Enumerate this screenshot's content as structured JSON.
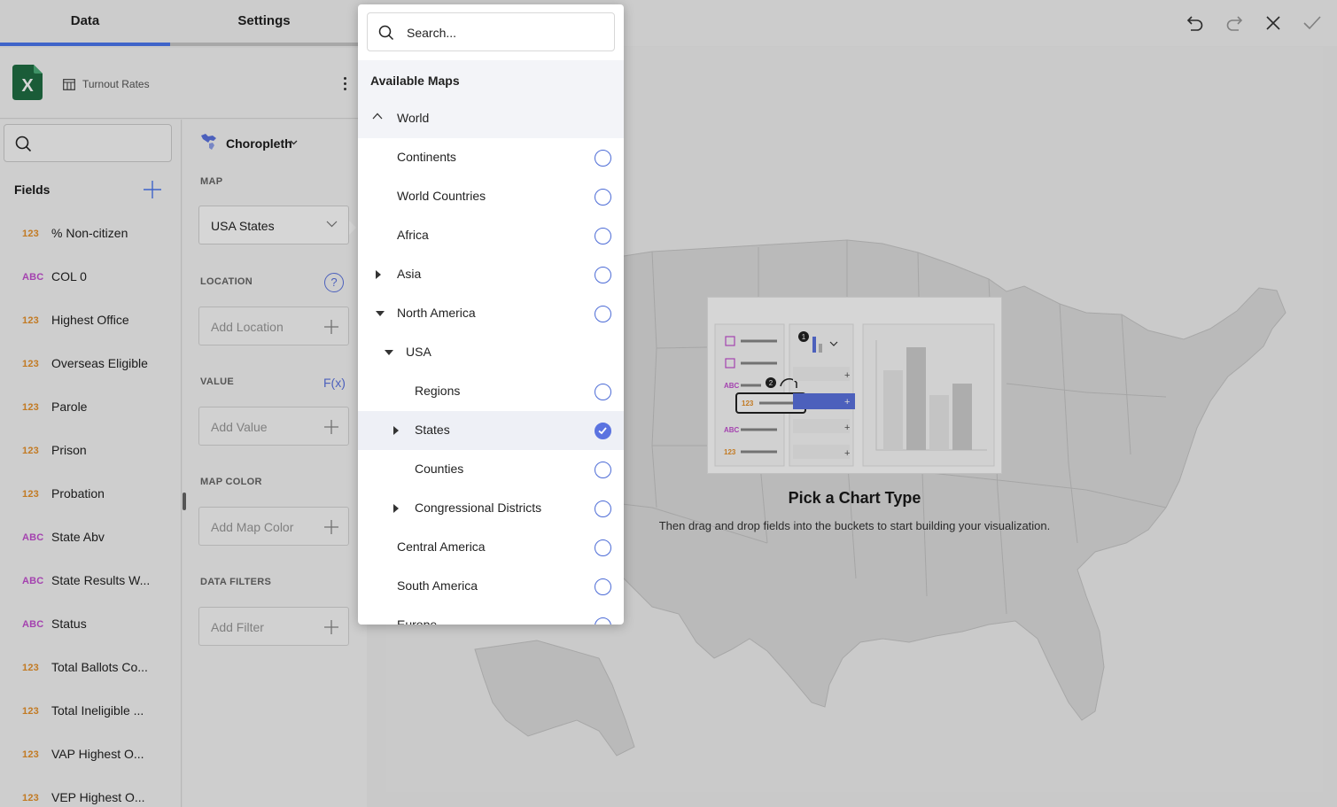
{
  "tabs": {
    "data": "Data",
    "settings": "Settings"
  },
  "source": {
    "name": "Turnout Rates",
    "icon": "excel-icon"
  },
  "fields": {
    "title": "Fields",
    "items": [
      {
        "type": "123",
        "label": "% Non-citizen"
      },
      {
        "type": "ABC",
        "label": "COL 0"
      },
      {
        "type": "123",
        "label": "Highest Office"
      },
      {
        "type": "123",
        "label": "Overseas Eligible"
      },
      {
        "type": "123",
        "label": "Parole"
      },
      {
        "type": "123",
        "label": "Prison"
      },
      {
        "type": "123",
        "label": "Probation"
      },
      {
        "type": "ABC",
        "label": "State Abv"
      },
      {
        "type": "ABC",
        "label": "State Results W..."
      },
      {
        "type": "ABC",
        "label": "Status"
      },
      {
        "type": "123",
        "label": "Total Ballots Co..."
      },
      {
        "type": "123",
        "label": "Total Ineligible ..."
      },
      {
        "type": "123",
        "label": "VAP Highest O..."
      },
      {
        "type": "123",
        "label": "VEP Highest O..."
      }
    ]
  },
  "config": {
    "chart_type": "Choropleth",
    "map_label": "MAP",
    "map_value": "USA States",
    "location_label": "LOCATION",
    "location_placeholder": "Add Location",
    "help": "?",
    "value_label": "VALUE",
    "fx": "F(x)",
    "value_placeholder": "Add Value",
    "map_color_label": "MAP COLOR",
    "map_color_placeholder": "Add Map Color",
    "filters_label": "DATA FILTERS",
    "filters_placeholder": "Add Filter"
  },
  "canvas": {
    "title": "Pick a Chart Type",
    "subtitle": "Then drag and drop fields into the buckets to start building your visualization.",
    "illus_types": [
      "ABC",
      "123",
      "ABC",
      "123"
    ],
    "illus_steps": [
      "1",
      "2"
    ],
    "illus_plus": "+"
  },
  "dropdown": {
    "search_placeholder": "Search...",
    "title": "Available Maps",
    "group": "World",
    "items": [
      {
        "label": "Continents",
        "selected": false
      },
      {
        "label": "World Countries",
        "selected": false
      },
      {
        "label": "Africa",
        "selected": false
      },
      {
        "label": "Asia",
        "selected": false
      },
      {
        "label": "North America",
        "selected": false
      },
      {
        "label": "USA"
      },
      {
        "label": "Regions",
        "selected": false
      },
      {
        "label": "States",
        "selected": true
      },
      {
        "label": "Counties",
        "selected": false
      },
      {
        "label": "Congressional Districts",
        "selected": false
      },
      {
        "label": "Central America",
        "selected": false
      },
      {
        "label": "South America",
        "selected": false
      },
      {
        "label": "Europe",
        "selected": false
      }
    ]
  },
  "colors": {
    "accent": "#4c78f0",
    "radio": "#5b73e0",
    "numeric_type": "#e8922a",
    "string_type": "#c44fd1"
  }
}
